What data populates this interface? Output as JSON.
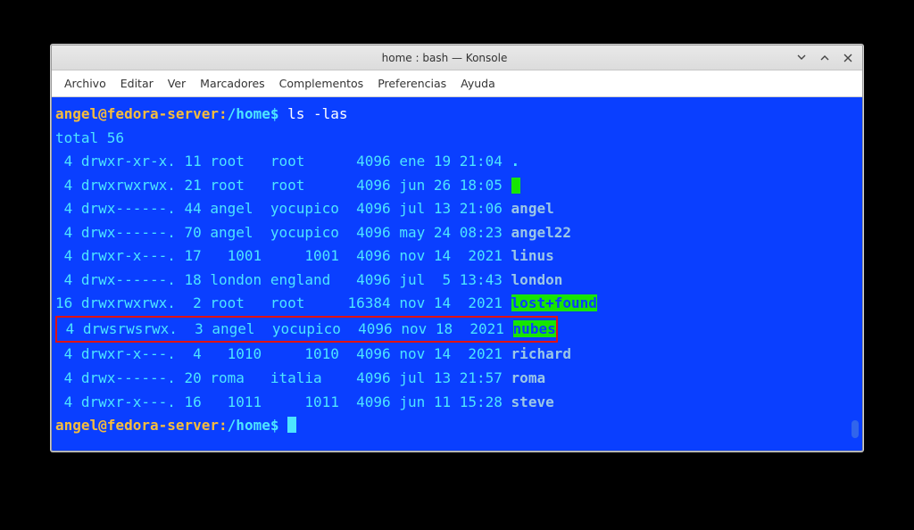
{
  "window": {
    "title": "home : bash — Konsole"
  },
  "menu": {
    "archivo": "Archivo",
    "editar": "Editar",
    "ver": "Ver",
    "marcadores": "Marcadores",
    "complementos": "Complementos",
    "preferencias": "Preferencias",
    "ayuda": "Ayuda"
  },
  "prompt": {
    "user": "angel@fedora-server",
    "sep": ":",
    "path": "/home",
    "dollar": "$"
  },
  "command": "ls -las",
  "total_line": "total 56",
  "listing": [
    {
      "blocks": " 4",
      "perm": "drwxr-xr-x.",
      "links": "11",
      "owner": "root  ",
      "group": "root    ",
      "size": " 4096",
      "date": "ene 19 21:04",
      "name": ".",
      "style": "dot"
    },
    {
      "blocks": " 4",
      "perm": "drwxrwxrwx.",
      "links": "21",
      "owner": "root  ",
      "group": "root    ",
      "size": " 4096",
      "date": "jun 26 18:05",
      "name": "",
      "style": "cursor"
    },
    {
      "blocks": " 4",
      "perm": "drwx------.",
      "links": "44",
      "owner": "angel ",
      "group": "yocupico",
      "size": " 4096",
      "date": "jul 13 21:06",
      "name": "angel",
      "style": "dir"
    },
    {
      "blocks": " 4",
      "perm": "drwx------.",
      "links": "70",
      "owner": "angel ",
      "group": "yocupico",
      "size": " 4096",
      "date": "may 24 08:23",
      "name": "angel22",
      "style": "dir"
    },
    {
      "blocks": " 4",
      "perm": "drwxr-x---.",
      "links": "17",
      "owner": "  1001",
      "group": "    1001",
      "size": " 4096",
      "date": "nov 14  2021",
      "name": "linus",
      "style": "dir"
    },
    {
      "blocks": " 4",
      "perm": "drwx------.",
      "links": "18",
      "owner": "london",
      "group": "england ",
      "size": " 4096",
      "date": "jul  5 13:43",
      "name": "london",
      "style": "dir"
    },
    {
      "blocks": "16",
      "perm": "drwxrwxrwx.",
      "links": " 2",
      "owner": "root  ",
      "group": "root    ",
      "size": "16384",
      "date": "nov 14  2021",
      "name": "lost+found",
      "style": "green"
    },
    {
      "blocks": " 4",
      "perm": "drwsrwsrwx.",
      "links": " 3",
      "owner": "angel ",
      "group": "yocupico",
      "size": " 4096",
      "date": "nov 18  2021",
      "name": "nubes",
      "style": "green",
      "highlighted": true
    },
    {
      "blocks": " 4",
      "perm": "drwxr-x---.",
      "links": " 4",
      "owner": "  1010",
      "group": "    1010",
      "size": " 4096",
      "date": "nov 14  2021",
      "name": "richard",
      "style": "dir"
    },
    {
      "blocks": " 4",
      "perm": "drwx------.",
      "links": "20",
      "owner": "roma  ",
      "group": "italia  ",
      "size": " 4096",
      "date": "jul 13 21:57",
      "name": "roma",
      "style": "dir"
    },
    {
      "blocks": " 4",
      "perm": "drwxr-x---.",
      "links": "16",
      "owner": "  1011",
      "group": "    1011",
      "size": " 4096",
      "date": "jun 11 15:28",
      "name": "steve",
      "style": "dir"
    }
  ],
  "colors": {
    "terminal_bg": "#0a3fff",
    "prompt_accent": "#f7bd3c",
    "text": "#4de5ff",
    "dir": "#9bc7e6",
    "highlight_green": "#16e600",
    "highlight_border": "#e11212"
  }
}
